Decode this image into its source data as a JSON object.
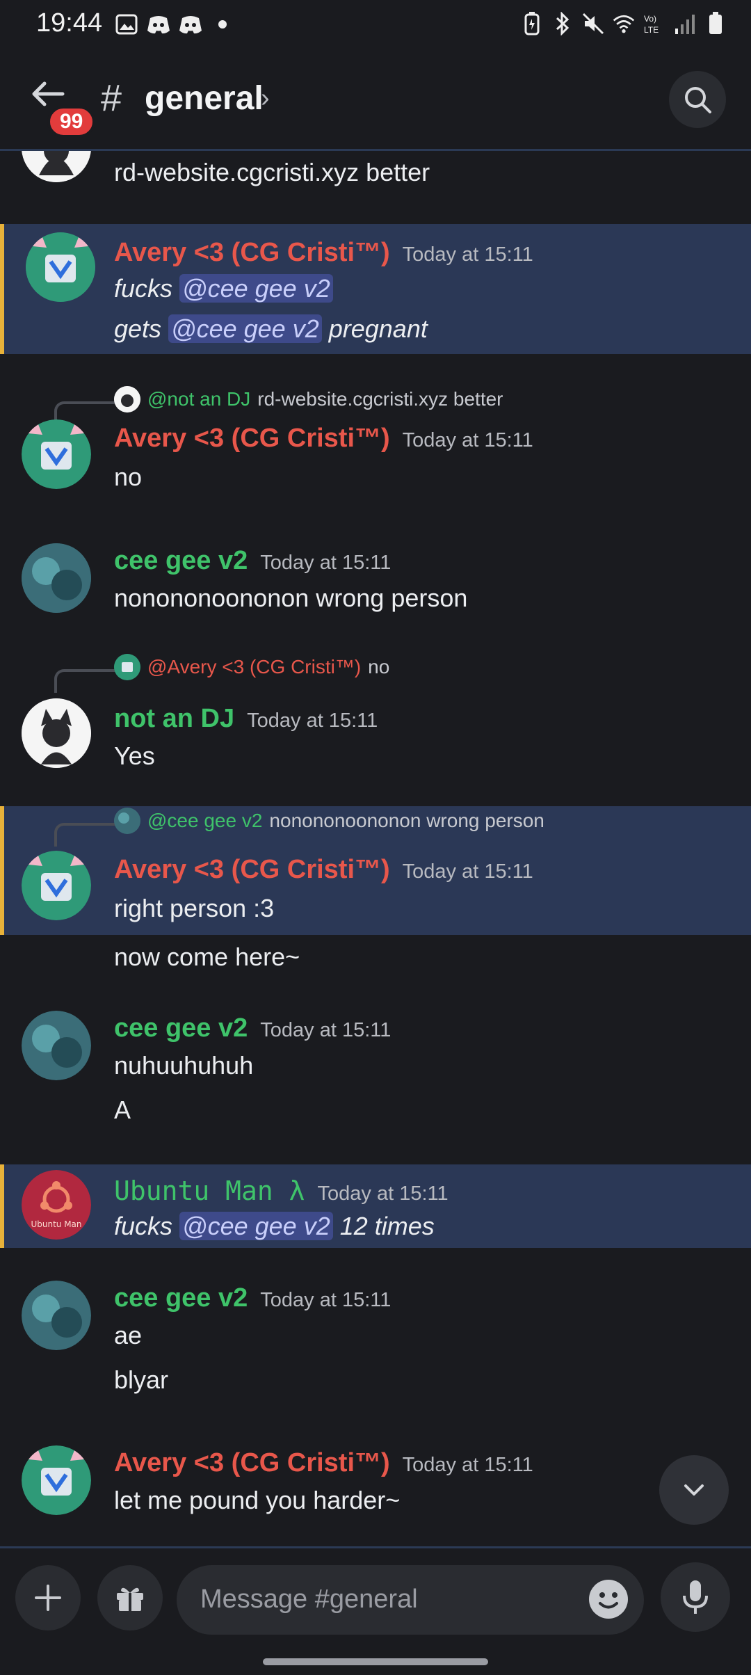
{
  "status_bar": {
    "time": "19:44"
  },
  "header": {
    "badge": "99",
    "hash": "#",
    "channel": "general",
    "chevron": "›"
  },
  "messages": {
    "m0": {
      "text": "rd-website.cgcristi.xyz better"
    },
    "m1": {
      "name": "Avery <3 (CG Cristi™)",
      "time": "Today at 15:11",
      "l1_pre": "fucks ",
      "l1_mention": "@cee gee v2",
      "l2_pre": "gets ",
      "l2_mention": "@cee gee v2",
      "l2_post": " pregnant"
    },
    "m2": {
      "reply_name": "@not an DJ",
      "reply_text": "rd-website.cgcristi.xyz better",
      "name": "Avery <3 (CG Cristi™)",
      "time": "Today at 15:11",
      "text": "no"
    },
    "m3": {
      "name": "cee gee v2",
      "time": "Today at 15:11",
      "text": "nonononoononon wrong person"
    },
    "m4": {
      "reply_name": "@Avery <3 (CG Cristi™)",
      "reply_text": "no",
      "name": "not an DJ",
      "time": "Today at 15:11",
      "text": "Yes"
    },
    "m5": {
      "reply_name": "@cee gee v2",
      "reply_text": "nonononoononon wrong person",
      "name": "Avery <3 (CG Cristi™)",
      "time": "Today at 15:11",
      "text": "right person :3"
    },
    "m5b": {
      "text": "now come here~"
    },
    "m6": {
      "name": "cee gee v2",
      "time": "Today at 15:11",
      "text": "nuhuuhuhuh",
      "text2": "A"
    },
    "m7": {
      "name": "Ubuntu Man λ",
      "time": "Today at 15:11",
      "pre": "fucks ",
      "mention": "@cee gee v2",
      "post": " 12 times",
      "avatar_text": "Ubuntu Man"
    },
    "m8": {
      "name": "cee gee v2",
      "time": "Today at 15:11",
      "text": "ae",
      "text2": "blyar"
    },
    "m9": {
      "name": "Avery <3 (CG Cristi™)",
      "time": "Today at 15:11",
      "text": "let me pound you harder~"
    }
  },
  "composer": {
    "placeholder": "Message #general"
  },
  "colors": {
    "highlight": "#2b3856",
    "highlight_bar": "#e8b23a",
    "red_role": "#e8574b",
    "green_role": "#3fc36a",
    "mention": "#3e4a8a"
  }
}
